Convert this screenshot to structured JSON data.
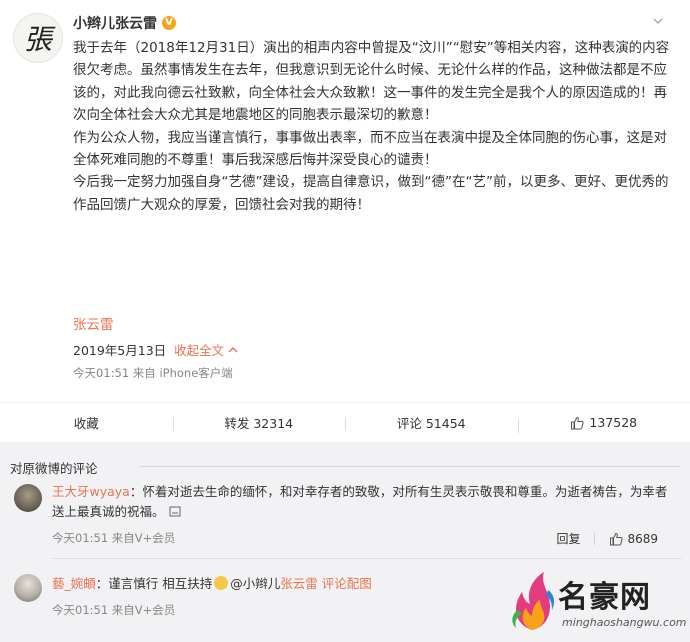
{
  "post": {
    "avatar_char": "張",
    "username": "小辫儿张云雷",
    "vip_badge": "V",
    "paragraphs": [
      "我于去年（2018年12月31日）演出的相声内容中曾提及“汶川”“慰安”等相关内容，这种表演的内容很欠考虑。虽然事情发生在去年，但我意识到无论什么时候、无论什么样的作品，这种做法都是不应该的，对此我向德云社致歉，向全体社会大众致歉！这一事件的发生完全是我个人的原因造成的！再次向全体社会大众尤其是地震地区的同胞表示最深切的歉意！",
      "作为公众人物，我应当谨言慎行，事事做出表率，而不应当在表演中提及全体同胞的伤心事，这是对全体死难同胞的不尊重！事后我深感后悔并深受良心的谴责！",
      "今后我一定努力加强自身“艺德”建设，提高自律意识，做到“德”在“艺”前，以更多、更好、更优秀的作品回馈广大观众的厚爱，回馈社会对我的期待！"
    ],
    "signature": "张云雷",
    "date": "2019年5月13日",
    "collapse_label": "收起全文",
    "source": "今天01:51 来自 iPhone客户端"
  },
  "actions": {
    "favorite_label": "收藏",
    "repost_label": "转发 32314",
    "comment_label": "评论 51454",
    "like_count": "137528"
  },
  "comments_section": {
    "header": "对原微博的评论",
    "items": [
      {
        "user": "王大牙wyaya",
        "text": "：怀着对逝去生命的缅怀，和对幸存者的致敬，对所有生灵表示敬畏和尊重。为逝者祷告，为幸者送上最真诚的祝福。",
        "meta": "今天01:51 来自V+会员",
        "reply_label": "回复",
        "like_count": "8689"
      },
      {
        "user": "藝_婉頔",
        "text_before": "：谨言慎行 相互扶持",
        "mention_prefix": "@小辫儿",
        "mention_name": "张云雷",
        "image_link": "评论配图",
        "meta": "今天01:51 来自V+会员"
      }
    ]
  },
  "watermark": {
    "title": "名豪网",
    "url": "minghaoshangwu.com"
  },
  "colors": {
    "accent": "#eb7350",
    "badge": "#f7a31c",
    "panel": "#f2f2f5"
  }
}
